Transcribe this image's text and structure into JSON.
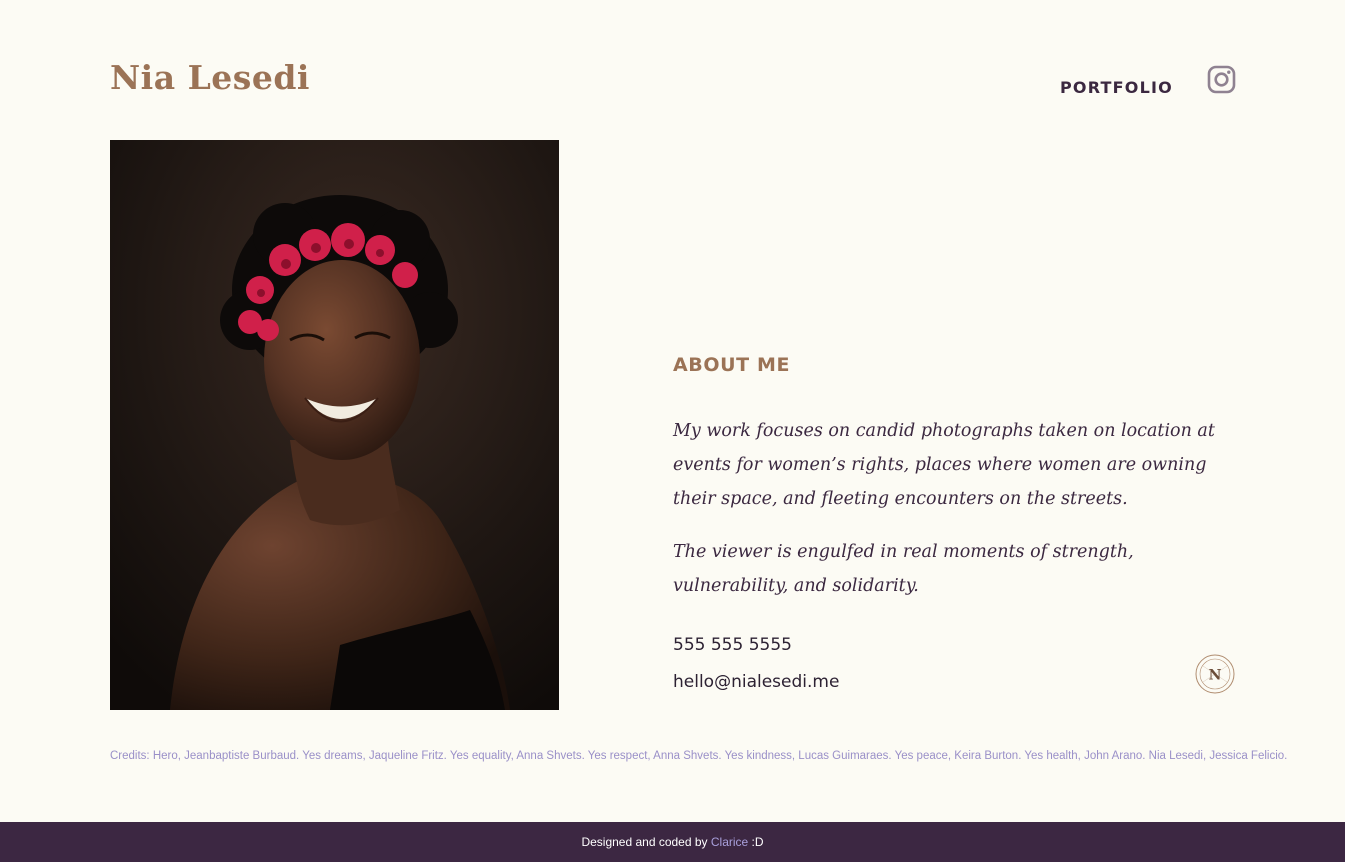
{
  "brand": {
    "name": "Nia Lesedi"
  },
  "nav": {
    "portfolio_label": "PORTFOLIO",
    "instagram_icon": "instagram-icon"
  },
  "hero": {
    "image_icon": "portrait-photo"
  },
  "about": {
    "title": "ABOUT ME",
    "paragraph1": "My work focuses on candid photographs taken on location at events for women’s rights, places where women are owning their space, and fleeting encounters on the streets.",
    "paragraph2": "The viewer is engulfed in real moments of strength, vulnerability, and solidarity.",
    "phone": "555 555 5555",
    "email": "hello@nialesedi.me",
    "monogram_letter": "N"
  },
  "credits": {
    "text": "Credits: Hero, Jeanbaptiste Burbaud. Yes dreams, Jaqueline Fritz. Yes equality, Anna Shvets. Yes respect, Anna Shvets. Yes kindness, Lucas Guimaraes. Yes peace, Keira Burton. Yes health, John Arano. Nia Lesedi, Jessica Felicio."
  },
  "footer": {
    "prefix": "Designed and coded by ",
    "author": "Clarice",
    "suffix": " :D"
  },
  "colors": {
    "background": "#fcfbf4",
    "brand_brown": "#9b7356",
    "text_dark_purple": "#3b2840",
    "credits_lavender": "#9a90c8",
    "footer_bg": "#3c2742"
  }
}
